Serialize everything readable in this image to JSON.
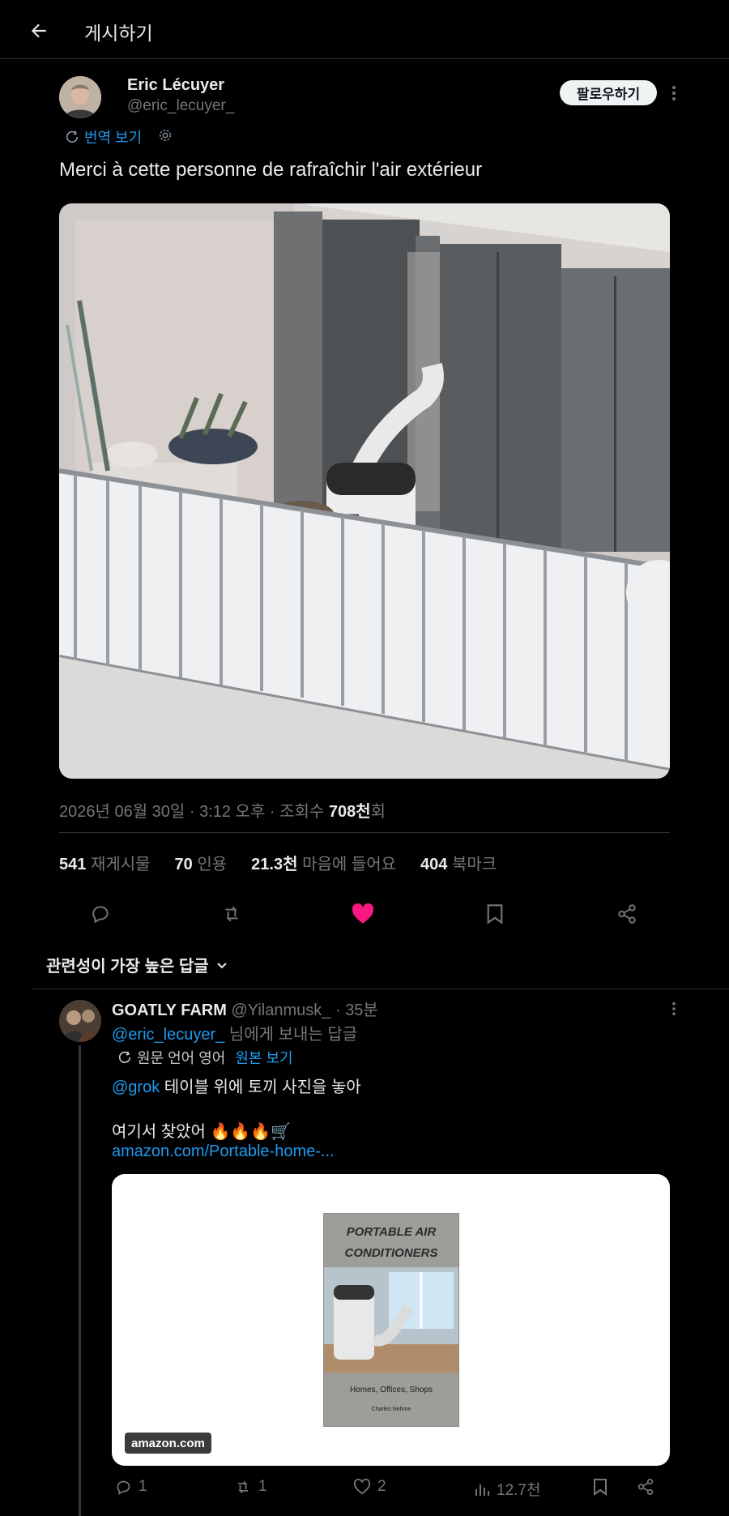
{
  "header": {
    "title": "게시하기"
  },
  "post": {
    "author_name": "Eric Lécuyer",
    "author_handle": "@eric_lecuyer_",
    "follow_label": "팔로우하기",
    "translate_label": "번역 보기",
    "text": "Merci à cette personne de rafraîchir l'air extérieur",
    "timestamp_prefix": "2026년 06월 30일 · 3:12 오후 · 조회수 ",
    "views": "708천",
    "views_suffix": "회",
    "reposts": "541",
    "reposts_label": "재게시물",
    "quotes": "70",
    "quotes_label": "인용",
    "likes": "21.3천",
    "likes_label": "마음에 들어요",
    "bookmarks": "404",
    "bookmarks_label": "북마크",
    "liked": true
  },
  "replies_sort": {
    "label": "관련성이 가장 높은 답글"
  },
  "reply": {
    "author_name": "GOATLY FARM",
    "author_handle": "@Yilanmusk_",
    "time": "· 35분",
    "replying_to_handle": "@eric_lecuyer_",
    "replying_to_suffix": " 님에게 보내는 답글",
    "source_lang_label": "원문 언어 영어",
    "show_original_label": "원본 보기",
    "mention": "@grok",
    "text_line1": " 테이블 위에 토끼 사진을 놓아",
    "text_line2": "여기서 찾았어 🔥🔥🔥🛒",
    "url": "amazon.com/Portable-home-...",
    "card_domain": "amazon.com",
    "book_title_line1": "PORTABLE AIR",
    "book_title_line2": "CONDITIONERS",
    "book_subtitle": "Homes, Offices, Shops",
    "book_author": "Charles Nehme",
    "replies": "1",
    "reposts": "1",
    "likes": "2",
    "views": "12.7천"
  },
  "colors": {
    "accent": "#1d9bf0",
    "like": "#f91880",
    "background": "#000000",
    "muted": "#71767b"
  },
  "icons": [
    "back-arrow-icon",
    "more-icon",
    "translate-icon",
    "gear-icon",
    "reply-icon",
    "repost-icon",
    "heart-icon",
    "bookmark-icon",
    "share-icon",
    "chevron-down-icon",
    "views-icon"
  ]
}
